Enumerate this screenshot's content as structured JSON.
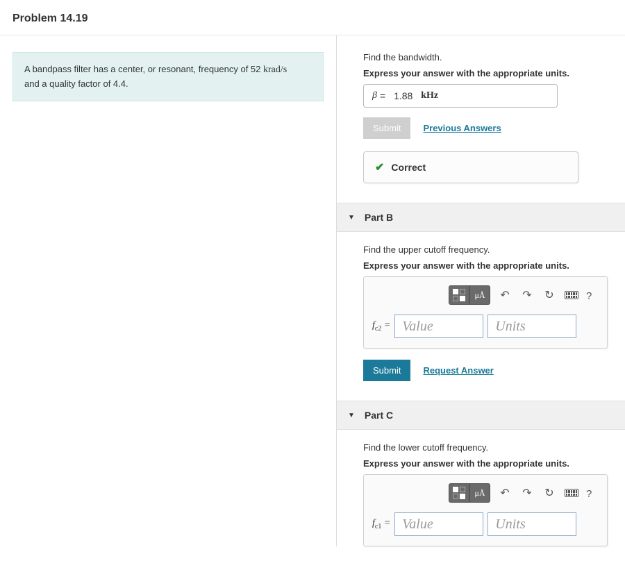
{
  "header": {
    "title": "Problem 14.19"
  },
  "prompt": {
    "line1_a": "A bandpass filter has a center, or resonant, frequency of 52 ",
    "line1_unit": "krad/s",
    "line2": "and a quality factor of 4.4."
  },
  "partA": {
    "instr": "Find the bandwidth.",
    "instr2": "Express your answer with the appropriate units.",
    "answer_var": "β",
    "answer_eq": "=",
    "answer_val": "1.88",
    "answer_unit": "kHz",
    "submit_label": "Submit",
    "prev_link": "Previous Answers",
    "correct_label": "Correct"
  },
  "partB": {
    "header": "Part B",
    "instr": "Find the upper cutoff frequency.",
    "instr2": "Express your answer with the appropriate units.",
    "var_html": "f_{c2} =",
    "value_ph": "Value",
    "units_ph": "Units",
    "submit_label": "Submit",
    "req_link": "Request Answer",
    "toolbar": {
      "units_btn": "μÅ"
    }
  },
  "partC": {
    "header": "Part C",
    "instr": "Find the lower cutoff frequency.",
    "instr2": "Express your answer with the appropriate units.",
    "var_html": "f_{c1} =",
    "value_ph": "Value",
    "units_ph": "Units",
    "toolbar": {
      "units_btn": "μÅ"
    }
  }
}
